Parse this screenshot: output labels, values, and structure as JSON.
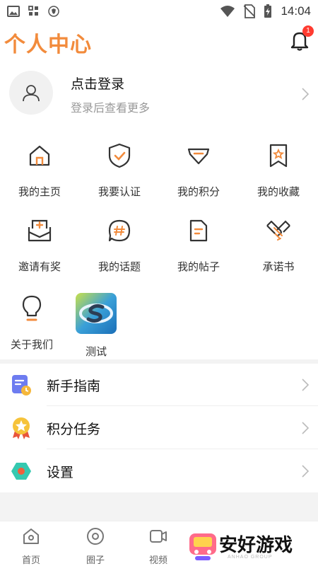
{
  "status_bar": {
    "time": "14:04"
  },
  "header": {
    "title": "个人中心",
    "notification_count": "1"
  },
  "login": {
    "title": "点击登录",
    "subtitle": "登录后查看更多"
  },
  "grid": [
    {
      "label": "我的主页",
      "icon": "home-icon"
    },
    {
      "label": "我要认证",
      "icon": "shield-check-icon"
    },
    {
      "label": "我的积分",
      "icon": "gem-icon"
    },
    {
      "label": "我的收藏",
      "icon": "bookmark-star-icon"
    },
    {
      "label": "邀请有奖",
      "icon": "invite-envelope-icon"
    },
    {
      "label": "我的话题",
      "icon": "hashtag-bubble-icon"
    },
    {
      "label": "我的帖子",
      "icon": "document-icon"
    },
    {
      "label": "承诺书",
      "icon": "handshake-icon"
    },
    {
      "label": "关于我们",
      "icon": "lightbulb-icon"
    },
    {
      "label": "测试",
      "icon": "app-logo-icon"
    }
  ],
  "menu": [
    {
      "label": "新手指南",
      "icon": "guide-clock-icon"
    },
    {
      "label": "积分任务",
      "icon": "medal-star-icon"
    },
    {
      "label": "设置",
      "icon": "settings-hexagon-icon"
    }
  ],
  "bottom_nav": [
    {
      "label": "首页",
      "icon": "home-nav-icon"
    },
    {
      "label": "圈子",
      "icon": "circle-nav-icon"
    },
    {
      "label": "视频",
      "icon": "video-nav-icon"
    }
  ],
  "watermark": {
    "text": "安好游戏",
    "sub": "ANHAO GROUP"
  },
  "colors": {
    "accent": "#f28b3c",
    "icon_dark": "#333333",
    "badge": "#ff3b30"
  }
}
